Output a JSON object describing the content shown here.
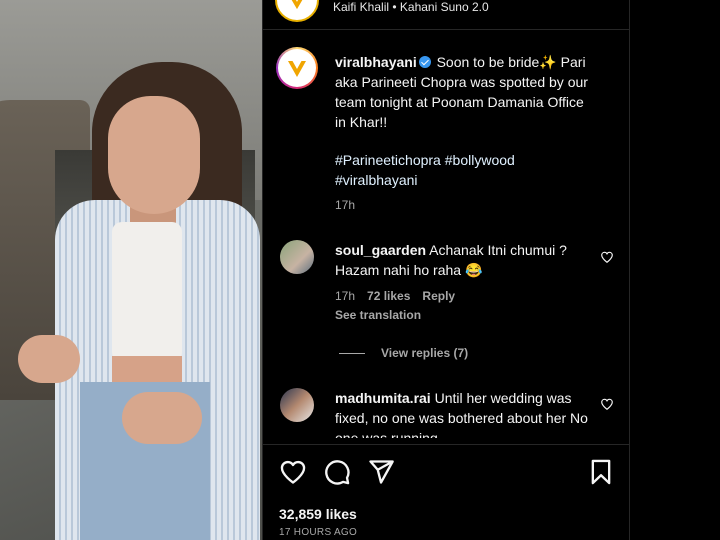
{
  "header": {
    "subtitle_author": "Kaifi Khalil",
    "subtitle_separator": " • ",
    "subtitle_track": "Kahani Suno 2.0"
  },
  "caption": {
    "username": "viralbhayani",
    "text_line1": " Soon to be bride",
    "sparkle": "✨",
    "text_rest": " Pari aka Parineeti Chopra was spotted by our team tonight at Poonam Damania Office in Khar!!",
    "hashtags": [
      "#Parineetichopra",
      "#bollywood",
      "#viralbhayani"
    ],
    "time": "17h"
  },
  "comments": [
    {
      "username": "soul_gaarden",
      "text": " Achanak Itni chumui ? Hazam nahi ho raha 😂",
      "time": "17h",
      "likes": "72 likes",
      "reply_label": "Reply",
      "translation_label": "See translation",
      "view_replies_label": "View replies (7)"
    },
    {
      "username": "madhumita.rai",
      "text": " Until her wedding was fixed, no one was bothered about her No one was running"
    }
  ],
  "footer": {
    "likes": "32,859 likes",
    "posted": "17 HOURS AGO"
  },
  "icons": {
    "like": "heart-icon",
    "comment": "comment-icon",
    "share": "paper-plane-icon",
    "save": "bookmark-icon",
    "verified": "verified-badge-icon"
  },
  "colors": {
    "background": "#000000",
    "text": "#f5f5f5",
    "secondary_text": "#a8a8a8",
    "hashtag": "#e0f1ff",
    "verified": "#3897f0"
  }
}
